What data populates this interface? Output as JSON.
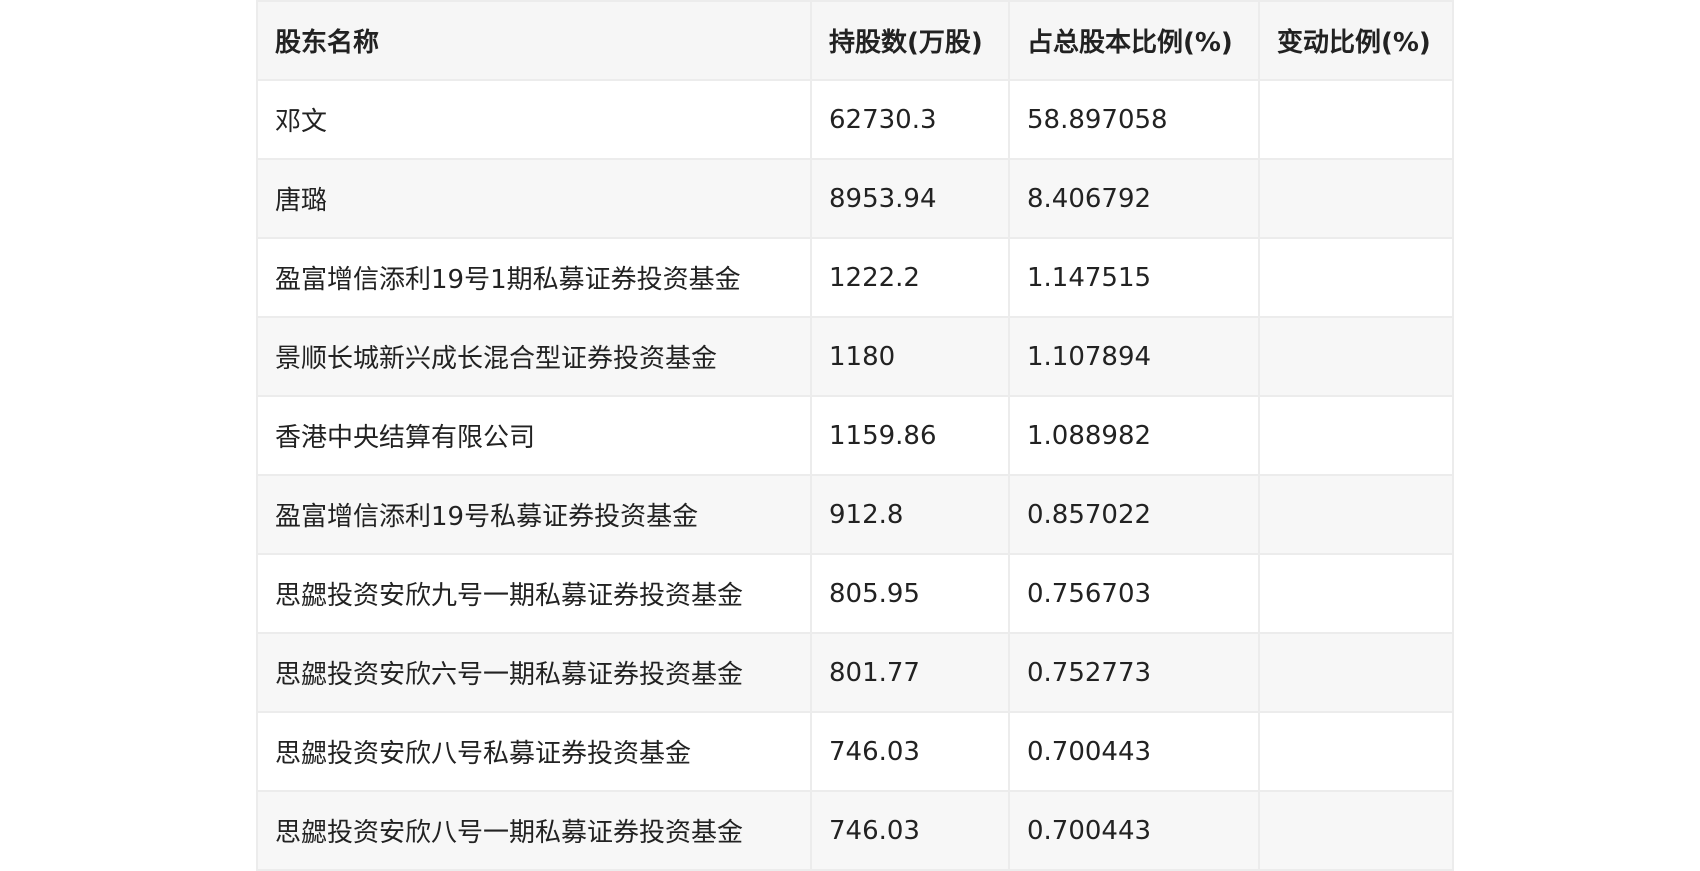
{
  "table": {
    "headers": [
      "股东名称",
      "持股数(万股)",
      "占总股本比例(%)",
      "变动比例(%)"
    ],
    "rows": [
      [
        "邓文",
        "62730.3",
        "58.897058",
        ""
      ],
      [
        "唐璐",
        "8953.94",
        "8.406792",
        ""
      ],
      [
        "盈富增信添利19号1期私募证券投资基金",
        "1222.2",
        "1.147515",
        ""
      ],
      [
        "景顺长城新兴成长混合型证券投资基金",
        "1180",
        "1.107894",
        ""
      ],
      [
        "香港中央结算有限公司",
        "1159.86",
        "1.088982",
        ""
      ],
      [
        "盈富增信添利19号私募证券投资基金",
        "912.8",
        "0.857022",
        ""
      ],
      [
        "思勰投资安欣九号一期私募证券投资基金",
        "805.95",
        "0.756703",
        ""
      ],
      [
        "思勰投资安欣六号一期私募证券投资基金",
        "801.77",
        "0.752773",
        ""
      ],
      [
        "思勰投资安欣八号私募证券投资基金",
        "746.03",
        "0.700443",
        ""
      ],
      [
        "思勰投资安欣八号一期私募证券投资基金",
        "746.03",
        "0.700443",
        ""
      ]
    ]
  }
}
